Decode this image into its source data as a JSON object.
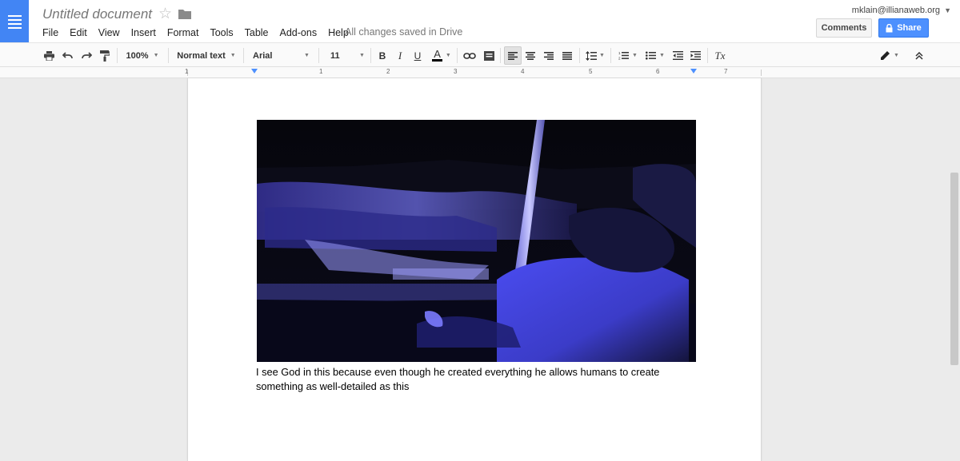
{
  "header": {
    "title": "Untitled document",
    "account_email": "mklain@illianaweb.org",
    "save_status": "All changes saved in Drive",
    "comments_label": "Comments",
    "share_label": "Share"
  },
  "menu": [
    "File",
    "Edit",
    "View",
    "Insert",
    "Format",
    "Tools",
    "Table",
    "Add-ons",
    "Help"
  ],
  "toolbar": {
    "zoom": "100%",
    "style": "Normal text",
    "font": "Arial",
    "font_size": "11",
    "bold": "B",
    "italic": "I",
    "underline": "U",
    "text_color": "A",
    "clear_formatting": "Tx"
  },
  "ruler": {
    "numbers": [
      "1",
      "1",
      "2",
      "3",
      "4",
      "5",
      "6",
      "7"
    ]
  },
  "document": {
    "body_text": "I see God in this because even though he created everything he allows humans to create something as well-detailed as this"
  },
  "colors": {
    "brand_blue": "#4285f4",
    "share_blue": "#4d90fe"
  }
}
